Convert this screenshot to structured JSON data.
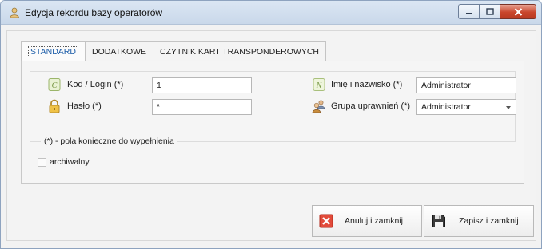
{
  "window": {
    "title": "Edycja rekordu bazy operatorów"
  },
  "tabs": [
    {
      "label": "STANDARD",
      "active": true
    },
    {
      "label": "DODATKOWE",
      "active": false
    },
    {
      "label": "CZYTNIK KART TRANSPONDEROWYCH",
      "active": false
    }
  ],
  "form": {
    "login_label": "Kod / Login (*)",
    "login_value": "1",
    "password_label": "Hasło (*)",
    "password_value": "*",
    "name_label": "Imię i nazwisko (*)",
    "name_value": "Administrator",
    "group_label": "Grupa uprawnień (*)",
    "group_value": "Administrator",
    "required_note": "(*) - pola konieczne do wypełnienia",
    "archived_label": "archiwalny",
    "archived_checked": false
  },
  "buttons": {
    "cancel_label": "Anuluj i zamknij",
    "save_label": "Zapisz i zamknij"
  },
  "icons": {
    "window": "user-icon",
    "login": "id-card-icon",
    "password": "padlock-icon",
    "name": "id-card-icon",
    "group": "users-group-icon",
    "cancel": "close-x-icon",
    "save": "floppy-disk-icon"
  },
  "colors": {
    "cancel_red": "#e24b3b",
    "title_close_red": "#c9462c",
    "active_tab_text": "#1b5ca8"
  }
}
